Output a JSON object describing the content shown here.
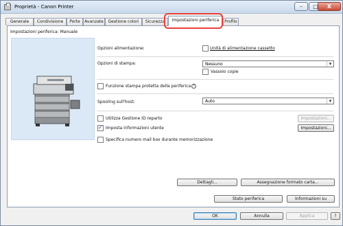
{
  "window": {
    "title": "Proprietà - Canon Printer",
    "controls": {
      "minimize": "–",
      "maximize": "□",
      "close": "X"
    }
  },
  "tabs": [
    "Generale",
    "Condivisione",
    "Porte",
    "Avanzate",
    "Gestione colori",
    "Sicurezza",
    "Impostazioni periferica",
    "Profilo"
  ],
  "active_tab": "Impostazioni periferica",
  "panel": {
    "heading": "Impostazioni periferica: Manuale",
    "options_feed_label": "Opzioni alimentazione:",
    "cassette_unit_label": "Unità di alimentazione cassetto",
    "print_options_label": "Opzioni di stampa:",
    "print_options_value": "Nessuno",
    "copy_tray_label": "Vassoio copie",
    "protected_print_label": "Funzione stampa protetta della periferica",
    "spooling_label": "Spooling sull'host:",
    "spooling_value": "Auto",
    "dept_id_label": "Utilizza Gestione ID reparto",
    "dept_id_settings": "Impostazioni...",
    "user_info_label": "Imposta informazioni utente",
    "user_info_settings": "Impostazioni...",
    "mailbox_label": "Specifica numero mail box durante memorizzazione",
    "details_button": "Dettagli...",
    "paper_size_button": "Assegnazione formato carta...",
    "device_status_button": "Stato periferica",
    "info_button": "Informazioni su"
  },
  "checkboxes": {
    "cassette_unit": false,
    "copy_tray": false,
    "protected_print": false,
    "dept_id": false,
    "user_info": true,
    "mailbox": false
  },
  "footer": {
    "ok": "OK",
    "cancel": "Annulla",
    "apply": "Applica",
    "help": "?"
  }
}
